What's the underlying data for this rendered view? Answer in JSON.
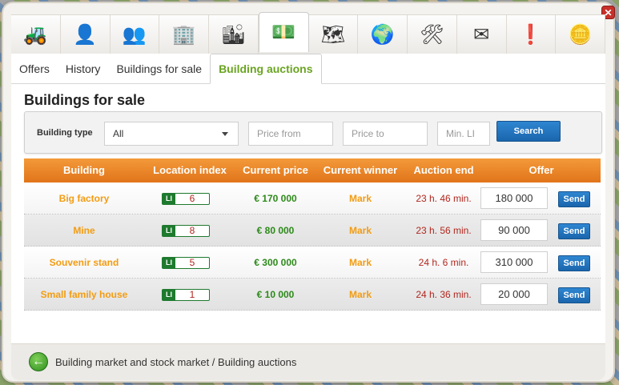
{
  "window": {
    "close_label": "✕"
  },
  "iconbar": [
    {
      "name": "bulldozer-icon",
      "glyph": "🚜"
    },
    {
      "name": "person-icon",
      "glyph": "👤"
    },
    {
      "name": "people-icon",
      "glyph": "👥"
    },
    {
      "name": "skyscraper-icon",
      "glyph": "🏢"
    },
    {
      "name": "buildings-icon",
      "glyph": "🏙"
    },
    {
      "name": "money-building-icon",
      "glyph": "💵"
    },
    {
      "name": "map-icon",
      "glyph": "🗺"
    },
    {
      "name": "globe-icon",
      "glyph": "🌍"
    },
    {
      "name": "tools-icon",
      "glyph": "🛠"
    },
    {
      "name": "envelope-icon",
      "glyph": "✉"
    },
    {
      "name": "info-icon",
      "glyph": "❗"
    },
    {
      "name": "coin-icon",
      "glyph": "🪙"
    }
  ],
  "tabs": [
    {
      "label": "Offers"
    },
    {
      "label": "History"
    },
    {
      "label": "Buildings for sale"
    },
    {
      "label": "Building auctions"
    }
  ],
  "page_title": "Buildings for sale",
  "filter": {
    "building_type_label": "Building type",
    "building_type_value": "All",
    "price_from_placeholder": "Price from",
    "price_to_placeholder": "Price to",
    "min_li_placeholder": "Min. LI",
    "search_label": "Search"
  },
  "table": {
    "headers": [
      "Building",
      "Location index",
      "Current price",
      "Current winner",
      "Auction end",
      "Offer"
    ],
    "li_tag": "LI",
    "send_label": "Send",
    "rows": [
      {
        "building": "Big factory",
        "li": "6",
        "price": "€ 170 000",
        "winner": "Mark",
        "end": "23 h. 46 min.",
        "offer": "180 000"
      },
      {
        "building": "Mine",
        "li": "8",
        "price": "€ 80 000",
        "winner": "Mark",
        "end": "23 h. 56 min.",
        "offer": "90 000"
      },
      {
        "building": "Souvenir stand",
        "li": "5",
        "price": "€ 300 000",
        "winner": "Mark",
        "end": "24 h. 6 min.",
        "offer": "310 000"
      },
      {
        "building": "Small family house",
        "li": "1",
        "price": "€ 10 000",
        "winner": "Mark",
        "end": "24 h. 36 min.",
        "offer": "20 000"
      }
    ]
  },
  "footer": {
    "breadcrumb": "Building market and stock market / Building auctions"
  },
  "colors": {
    "accent_green": "#6aa421",
    "header_orange": "#e1741a",
    "button_blue": "#1a66ad"
  }
}
